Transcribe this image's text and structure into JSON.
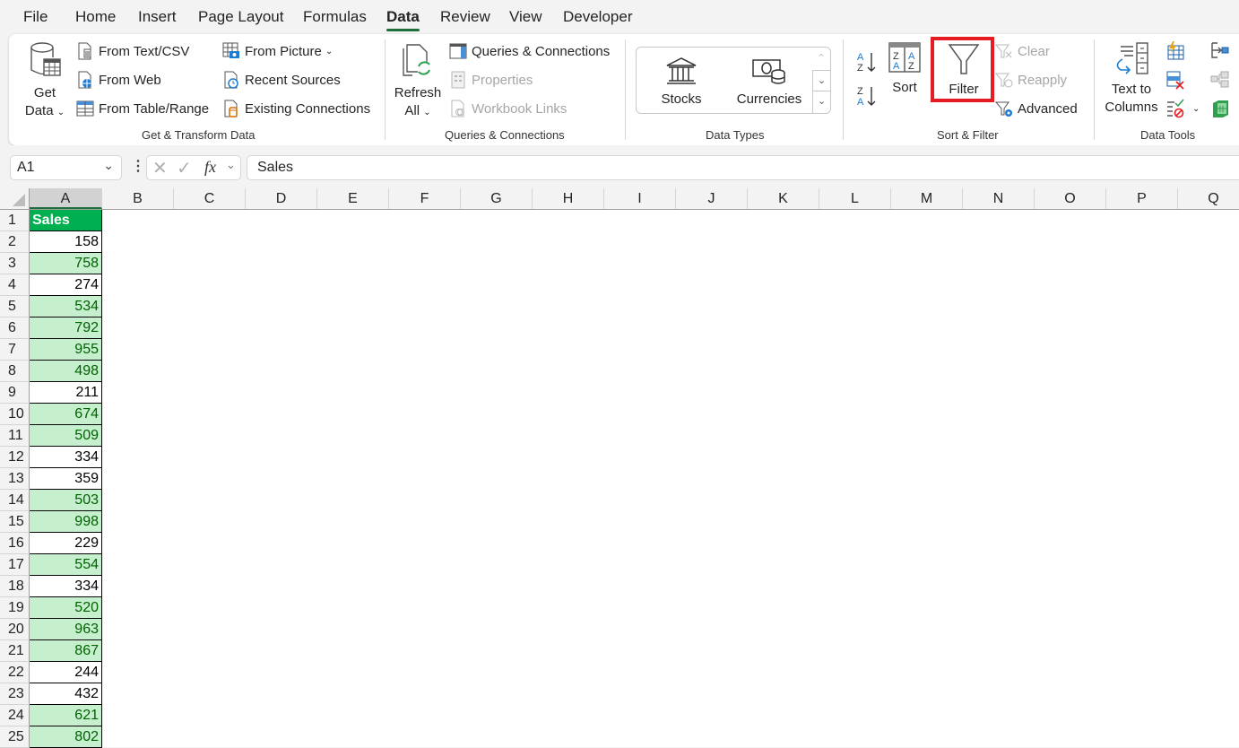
{
  "menu_tabs": [
    "File",
    "Home",
    "Insert",
    "Page Layout",
    "Formulas",
    "Data",
    "Review",
    "View",
    "Developer"
  ],
  "active_tab": "Data",
  "ribbon": {
    "get_transform": {
      "get_data": [
        "Get",
        "Data"
      ],
      "from_text_csv": "From Text/CSV",
      "from_web": "From Web",
      "from_table_range": "From Table/Range",
      "from_picture": "From Picture",
      "recent_sources": "Recent Sources",
      "existing_connections": "Existing Connections",
      "group_label": "Get & Transform Data"
    },
    "queries": {
      "refresh_all": [
        "Refresh",
        "All"
      ],
      "queries_connections": "Queries & Connections",
      "properties": "Properties",
      "workbook_links": "Workbook Links",
      "group_label": "Queries & Connections"
    },
    "data_types": {
      "stocks": "Stocks",
      "currencies": "Currencies",
      "group_label": "Data Types"
    },
    "sort_filter": {
      "sort": "Sort",
      "filter": "Filter",
      "clear": "Clear",
      "reapply": "Reapply",
      "advanced": "Advanced",
      "group_label": "Sort & Filter"
    },
    "data_tools": {
      "text_to_columns": [
        "Text to",
        "Columns"
      ],
      "group_label": "Data Tools"
    }
  },
  "formula_bar": {
    "name_box": "A1",
    "formula": "Sales",
    "fx": "fx"
  },
  "columns": [
    "A",
    "B",
    "C",
    "D",
    "E",
    "F",
    "G",
    "H",
    "I",
    "J",
    "K",
    "L",
    "M",
    "N",
    "O",
    "P",
    "Q"
  ],
  "selected_column": "A",
  "sheet": {
    "header": "Sales",
    "rows": [
      {
        "row": 1,
        "value": "Sales",
        "style": "hdr"
      },
      {
        "row": 2,
        "value": "158",
        "style": "plain"
      },
      {
        "row": 3,
        "value": "758",
        "style": "hl"
      },
      {
        "row": 4,
        "value": "274",
        "style": "plain"
      },
      {
        "row": 5,
        "value": "534",
        "style": "hl"
      },
      {
        "row": 6,
        "value": "792",
        "style": "hl"
      },
      {
        "row": 7,
        "value": "955",
        "style": "hl"
      },
      {
        "row": 8,
        "value": "498",
        "style": "hl"
      },
      {
        "row": 9,
        "value": "211",
        "style": "plain"
      },
      {
        "row": 10,
        "value": "674",
        "style": "hl"
      },
      {
        "row": 11,
        "value": "509",
        "style": "hl"
      },
      {
        "row": 12,
        "value": "334",
        "style": "plain"
      },
      {
        "row": 13,
        "value": "359",
        "style": "plain"
      },
      {
        "row": 14,
        "value": "503",
        "style": "hl"
      },
      {
        "row": 15,
        "value": "998",
        "style": "hl"
      },
      {
        "row": 16,
        "value": "229",
        "style": "plain"
      },
      {
        "row": 17,
        "value": "554",
        "style": "hl"
      },
      {
        "row": 18,
        "value": "334",
        "style": "plain"
      },
      {
        "row": 19,
        "value": "520",
        "style": "hl"
      },
      {
        "row": 20,
        "value": "963",
        "style": "hl"
      },
      {
        "row": 21,
        "value": "867",
        "style": "hl"
      },
      {
        "row": 22,
        "value": "244",
        "style": "plain"
      },
      {
        "row": 23,
        "value": "432",
        "style": "plain"
      },
      {
        "row": 24,
        "value": "621",
        "style": "hl"
      },
      {
        "row": 25,
        "value": "802",
        "style": "hl"
      }
    ]
  },
  "colors": {
    "header_fill": "#00b050",
    "highlight_fill": "#c6efce",
    "highlight_text": "#006100",
    "filter_outline": "#e51c23",
    "accent": "#1e6e3c"
  }
}
